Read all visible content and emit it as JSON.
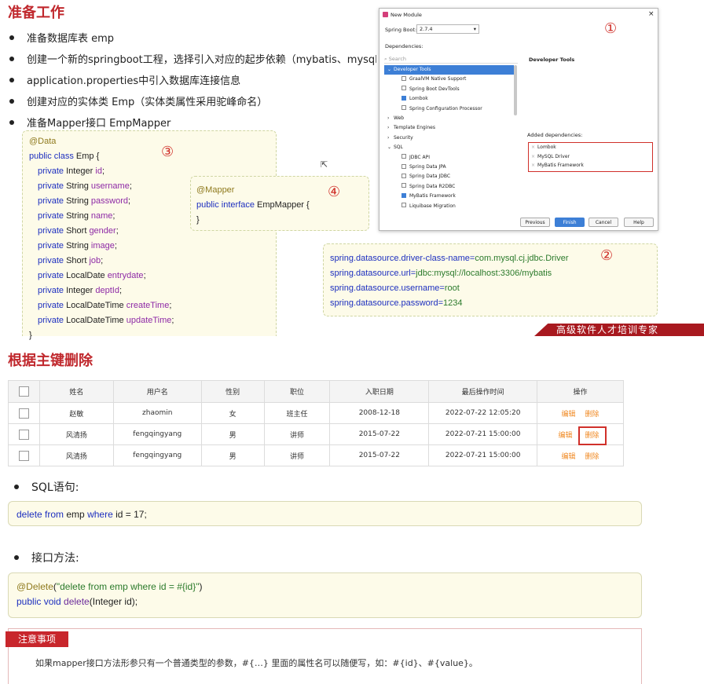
{
  "prep": {
    "title": "准备工作",
    "bullets": [
      "准备数据库表 emp",
      "创建一个新的springboot工程，选择引入对应的起步依赖（mybatis、mysql",
      "application.properties中引入数据库连接信息",
      "创建对应的实体类 Emp（实体类属性采用驼峰命名）",
      "准备Mapper接口 EmpMapper"
    ]
  },
  "emp_code": {
    "annotation": "@Data",
    "decl_kw": "public class",
    "decl_rest": " Emp {",
    "circle": "③",
    "fields": [
      {
        "kw": "private",
        "type": " Integer ",
        "name": "id"
      },
      {
        "kw": "private",
        "type": " String ",
        "name": "username"
      },
      {
        "kw": "private",
        "type": " String ",
        "name": "password"
      },
      {
        "kw": "private",
        "type": " String ",
        "name": "name"
      },
      {
        "kw": "private",
        "type": " Short ",
        "name": "gender"
      },
      {
        "kw": "private",
        "type": " String ",
        "name": "image"
      },
      {
        "kw": "private",
        "type": " Short ",
        "name": "job"
      },
      {
        "kw": "private",
        "type": " LocalDate ",
        "name": "entrydate"
      },
      {
        "kw": "private",
        "type": " Integer ",
        "name": "deptId"
      },
      {
        "kw": "private",
        "type": " LocalDateTime ",
        "name": "createTime"
      },
      {
        "kw": "private",
        "type": " LocalDateTime ",
        "name": "updateTime"
      }
    ],
    "close": "}"
  },
  "mapper_code": {
    "annotation": "@Mapper",
    "circle": "④",
    "decl_kw": "public interface",
    "decl_rest": " EmpMapper {",
    "close": "}"
  },
  "props": {
    "circle": "②",
    "lines": [
      {
        "key": "spring.datasource.driver-class-name=",
        "val": "com.mysql.cj.jdbc.Driver"
      },
      {
        "key": "spring.datasource.url=",
        "val": "jdbc:mysql://localhost:3306/mybatis"
      },
      {
        "key": "spring.datasource.username=",
        "val": "root"
      },
      {
        "key": "spring.datasource.password=",
        "val": "1234"
      }
    ]
  },
  "dialog": {
    "title": "New Module",
    "circle": "①",
    "springboot_label": "Spring Boot:",
    "springboot_version": "2.7.4",
    "dependencies_label": "Dependencies:",
    "search_placeholder": "Search",
    "tree": [
      {
        "label": "Developer Tools",
        "type": "group-open",
        "selected": true
      },
      {
        "label": "GraalVM Native Support",
        "type": "item",
        "checked": false
      },
      {
        "label": "Spring Boot DevTools",
        "type": "item",
        "checked": false
      },
      {
        "label": "Lombok",
        "type": "item",
        "checked": true
      },
      {
        "label": "Spring Configuration Processor",
        "type": "item",
        "checked": false
      },
      {
        "label": "Web",
        "type": "group"
      },
      {
        "label": "Template Engines",
        "type": "group"
      },
      {
        "label": "Security",
        "type": "group"
      },
      {
        "label": "SQL",
        "type": "group-open"
      },
      {
        "label": "JDBC API",
        "type": "item",
        "checked": false
      },
      {
        "label": "Spring Data JPA",
        "type": "item",
        "checked": false
      },
      {
        "label": "Spring Data JDBC",
        "type": "item",
        "checked": false
      },
      {
        "label": "Spring Data R2DBC",
        "type": "item",
        "checked": false
      },
      {
        "label": "MyBatis Framework",
        "type": "item",
        "checked": true
      },
      {
        "label": "Liquibase Migration",
        "type": "item",
        "checked": false
      }
    ],
    "detail_title": "Developer Tools",
    "added_label": "Added dependencies:",
    "added": [
      "Lombok",
      "MySQL Driver",
      "MyBatis Framework"
    ],
    "buttons": {
      "previous": "Previous",
      "finish": "Finish",
      "cancel": "Cancel",
      "help": "Help"
    }
  },
  "banner": "高级软件人才培训专家",
  "delete_section": {
    "title": "根据主键删除",
    "table": {
      "headers": [
        "姓名",
        "用户名",
        "性别",
        "职位",
        "入职日期",
        "最后操作时间",
        "操作"
      ],
      "rows": [
        [
          "赵敏",
          "zhaomin",
          "女",
          "班主任",
          "2008-12-18",
          "2022-07-22 12:05:20"
        ],
        [
          "风清扬",
          "fengqingyang",
          "男",
          "讲师",
          "2015-07-22",
          "2022-07-21 15:00:00"
        ],
        [
          "风清扬",
          "fengqingyang",
          "男",
          "讲师",
          "2015-07-22",
          "2022-07-21 15:00:00"
        ]
      ],
      "edit_label": "编辑",
      "delete_label": "删除"
    },
    "sql_label": "SQL语句:",
    "sql": {
      "kw1": "delete",
      "sp1": " ",
      "kw2": "from",
      "mid": " emp ",
      "kw3": "where",
      "rest": " id = 17;"
    },
    "method_label": "接口方法:",
    "method": {
      "ann": "@Delete",
      "open": "(",
      "str": "\"delete from emp where id = #{id}\"",
      "close": ")",
      "kw": "public void",
      "rest_name": " delete",
      "rest_args": "(Integer id);"
    },
    "note_tag": "注意事项",
    "note_text": "如果mapper接口方法形参只有一个普通类型的参数，#{…} 里面的属性名可以随便写，如：#{id}、#{value}。"
  }
}
